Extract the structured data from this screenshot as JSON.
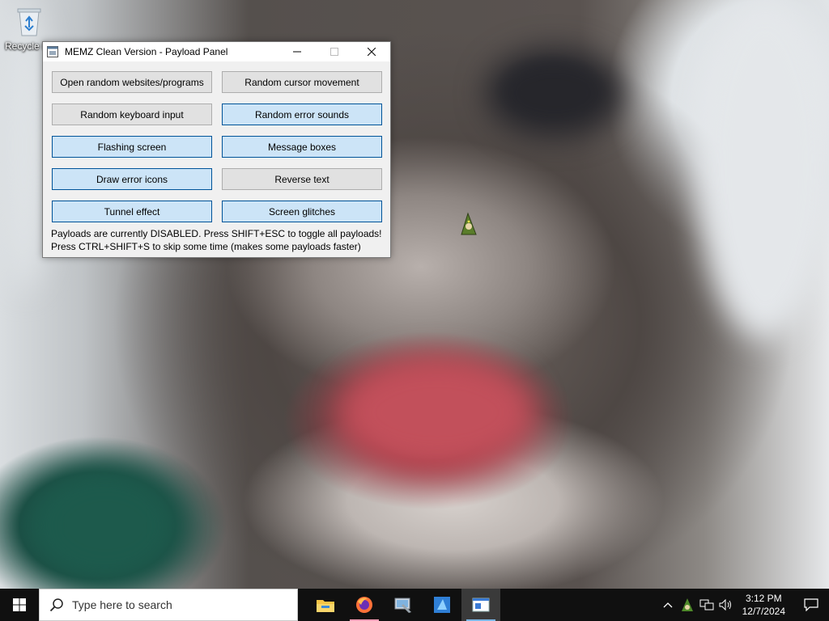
{
  "desktop": {
    "recycle_bin_label": "Recycle Bin"
  },
  "window": {
    "title": "MEMZ Clean Version - Payload Panel",
    "buttons": [
      {
        "label": "Open random websites/programs",
        "enabled": false
      },
      {
        "label": "Random cursor movement",
        "enabled": false
      },
      {
        "label": "Random keyboard input",
        "enabled": false
      },
      {
        "label": "Random error sounds",
        "enabled": true
      },
      {
        "label": "Flashing screen",
        "enabled": true
      },
      {
        "label": "Message boxes",
        "enabled": true
      },
      {
        "label": "Draw error icons",
        "enabled": true
      },
      {
        "label": "Reverse text",
        "enabled": false
      },
      {
        "label": "Tunnel effect",
        "enabled": true
      },
      {
        "label": "Screen glitches",
        "enabled": true
      }
    ],
    "status_line_1": "Payloads are currently DISABLED. Press SHIFT+ESC to toggle all payloads!",
    "status_line_2": "Press CTRL+SHIFT+S to skip some time (makes some payloads faster)"
  },
  "taskbar": {
    "search_placeholder": "Type here to search",
    "apps": [
      "file-explorer",
      "firefox",
      "control-panel",
      "visual-studio",
      "memz-panel"
    ],
    "clock_time": "3:12 PM",
    "clock_date": "12/7/2024"
  },
  "colors": {
    "button_off": "#e1e1e1",
    "button_on": "#cce4f7",
    "taskbar": "#101010",
    "firefox_underline": "#fb9fb7"
  }
}
